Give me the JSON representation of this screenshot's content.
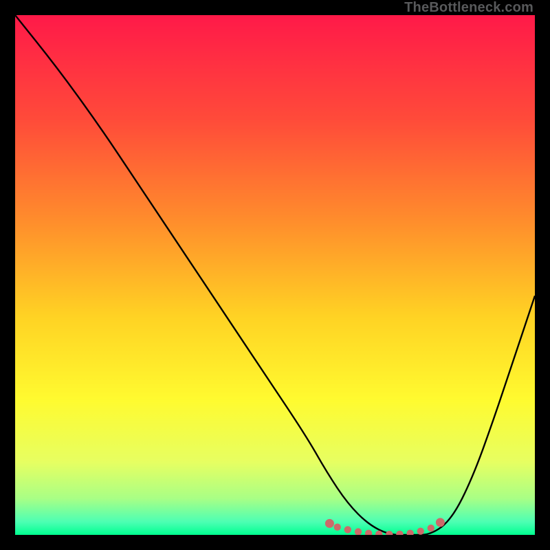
{
  "watermark": {
    "text": "TheBottleneck.com"
  },
  "chart_data": {
    "type": "line",
    "title": "",
    "xlabel": "",
    "ylabel": "",
    "xlim": [
      0,
      100
    ],
    "ylim": [
      0,
      100
    ],
    "grid": false,
    "legend": false,
    "series": [
      {
        "name": "bottleneck-curve",
        "x": [
          0,
          8,
          16,
          24,
          32,
          40,
          48,
          56,
          60,
          64,
          68,
          72,
          76,
          80,
          84,
          88,
          92,
          96,
          100
        ],
        "values": [
          100,
          90,
          79,
          67,
          55,
          43,
          31,
          19,
          12,
          6,
          2,
          0,
          0,
          0,
          3,
          11,
          22,
          34,
          46
        ],
        "color": "#000000"
      }
    ],
    "highlight": {
      "name": "sweet-spot",
      "color": "#cc6a6a",
      "points_x": [
        60.5,
        62,
        64,
        66,
        68,
        70,
        72,
        74,
        76,
        78,
        80,
        81.8
      ],
      "points_y": [
        2.2,
        1.5,
        1.0,
        0.6,
        0.3,
        0.15,
        0.1,
        0.15,
        0.3,
        0.7,
        1.3,
        2.4
      ]
    },
    "background_gradient": {
      "stops": [
        {
          "pos": 0.0,
          "color": "#ff1a49"
        },
        {
          "pos": 0.2,
          "color": "#ff4b3a"
        },
        {
          "pos": 0.4,
          "color": "#ff8f2c"
        },
        {
          "pos": 0.58,
          "color": "#ffd324"
        },
        {
          "pos": 0.74,
          "color": "#fffb30"
        },
        {
          "pos": 0.86,
          "color": "#e7ff62"
        },
        {
          "pos": 0.93,
          "color": "#a9ff86"
        },
        {
          "pos": 0.975,
          "color": "#4dffb4"
        },
        {
          "pos": 1.0,
          "color": "#00ff90"
        }
      ]
    }
  }
}
